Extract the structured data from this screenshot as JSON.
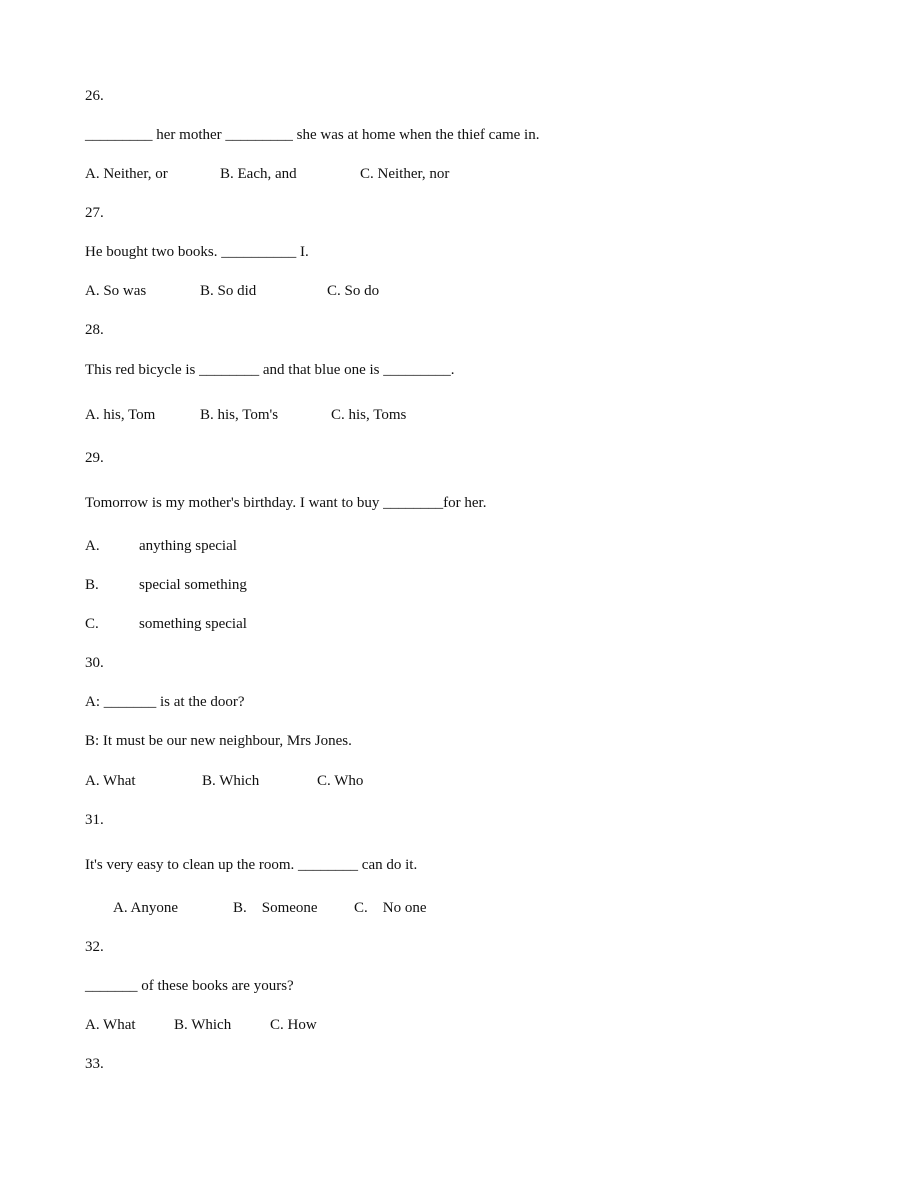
{
  "questions": [
    {
      "number": "26.",
      "stem": "_________ her mother _________ she was at home when the thief came in.",
      "options": [
        "A. Neither, or",
        "B. Each, and",
        "C. Neither, nor"
      ]
    },
    {
      "number": "27.",
      "stem": "He bought two books. __________ I.",
      "options": [
        "A. So was",
        "B. So did",
        "C. So do"
      ]
    },
    {
      "number": "28.",
      "stem": "This red bicycle is ________ and that blue one is _________.",
      "options": [
        "A. his, Tom",
        "B. his, Tom's",
        "C. his, Toms"
      ]
    },
    {
      "number": "29.",
      "stem": "Tomorrow is my mother's birthday. I want to buy ________for her.",
      "options": [
        {
          "letter": "A.",
          "text": "anything special"
        },
        {
          "letter": "B.",
          "text": "special something"
        },
        {
          "letter": "C.",
          "text": "something special"
        }
      ]
    },
    {
      "number": "30.",
      "stem_lines": [
        "A: _______ is at the door?",
        "B: It must be our new neighbour, Mrs Jones."
      ],
      "options": [
        "A. What",
        "B. Which",
        "C. Who"
      ]
    },
    {
      "number": "31.",
      "stem": "It's very easy to clean up the room. ________ can do it.",
      "options": [
        "A. Anyone",
        "B.    Someone",
        "C.    No one"
      ]
    },
    {
      "number": "32.",
      "stem": "_______ of these books are yours?",
      "options": [
        "A. What",
        "B. Which",
        "C. How"
      ]
    },
    {
      "number": "33."
    }
  ]
}
